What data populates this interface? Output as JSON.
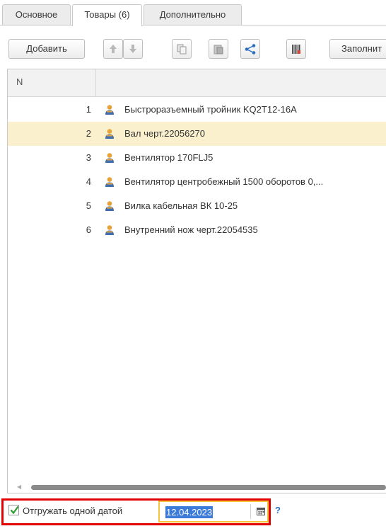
{
  "tabs": [
    {
      "label": "Основное",
      "active": false
    },
    {
      "label": "Товары (6)",
      "active": true
    },
    {
      "label": "Дополнительно",
      "active": false
    }
  ],
  "toolbar": {
    "add_label": "Добавить",
    "fill_label": "Заполнит",
    "icons": [
      "move-up-icon",
      "move-down-icon",
      "copy-icon",
      "paste-icon",
      "share-icon",
      "barcode-icon"
    ]
  },
  "table": {
    "columns": [
      "N",
      ""
    ],
    "rows": [
      {
        "n": "1",
        "name": "Быстроразъемный тройник KQ2T12-16A",
        "selected": false
      },
      {
        "n": "2",
        "name": "Вал черт.22056270",
        "selected": true
      },
      {
        "n": "3",
        "name": "Вентилятор 170FLJ5",
        "selected": false
      },
      {
        "n": "4",
        "name": "Вентилятор центробежный 1500 оборотов 0,...",
        "selected": false
      },
      {
        "n": "5",
        "name": "Вилка кабельная ВК 10-25",
        "selected": false
      },
      {
        "n": "6",
        "name": "Внутренний нож черт.22054535",
        "selected": false
      }
    ],
    "row_icon": "person-icon"
  },
  "footer": {
    "checkbox_label": "Отгружать одной датой",
    "checkbox_checked": true,
    "date_value": "12.04.2023",
    "help_label": "?"
  },
  "colors": {
    "selected_row": "#fbf0cd",
    "highlight_border": "#e30000",
    "focus_border": "#f5c33b",
    "text_selection": "#3d7bd9",
    "checkmark": "#2e9b2e",
    "link": "#2a73c7"
  }
}
